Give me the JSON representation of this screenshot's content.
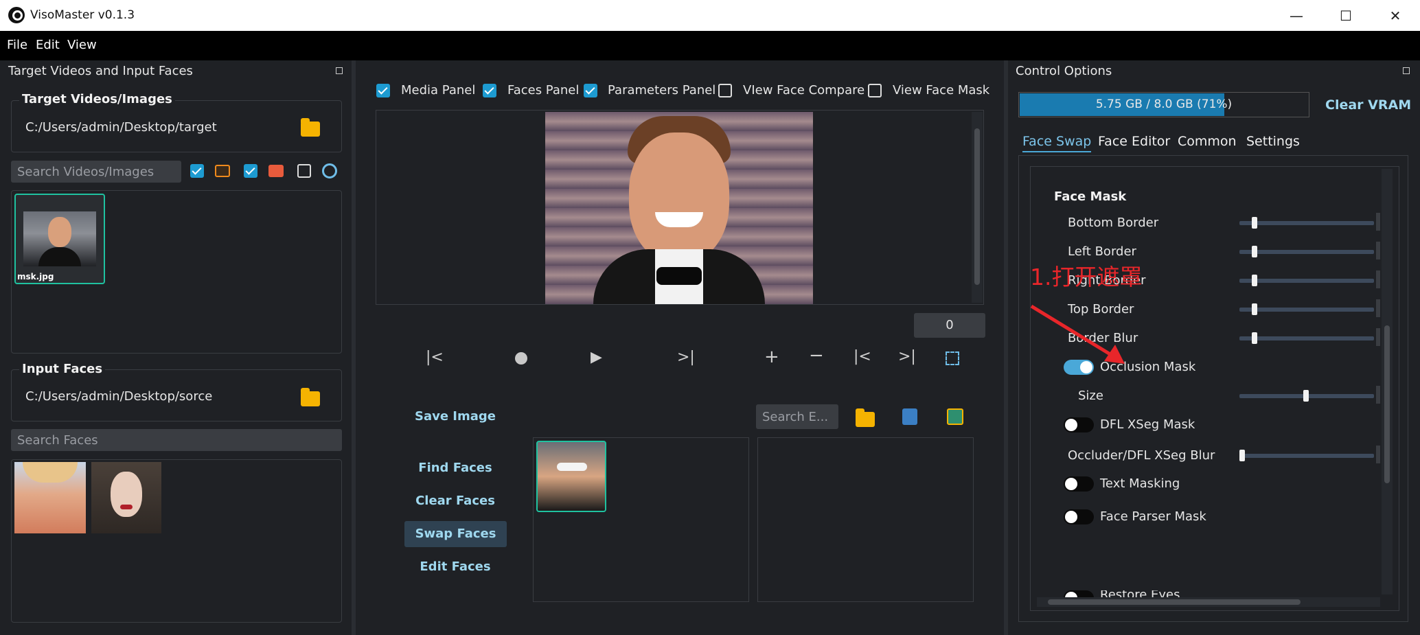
{
  "window": {
    "title": "VisoMaster v0.1.3",
    "minimize": "—",
    "maximize": "☐",
    "close": "✕"
  },
  "menu": [
    "File",
    "Edit",
    "View"
  ],
  "left": {
    "title": "Target Videos and Input Faces",
    "target_group": "Target Videos/Images",
    "target_path": "C:/Users/admin/Desktop/target",
    "target_search_placeholder": "Search Videos/Images",
    "thumb_label": "msk.jpg",
    "input_group": "Input Faces",
    "input_path": "C:/Users/admin/Desktop/sorce",
    "faces_search_placeholder": "Search Faces"
  },
  "center": {
    "checkboxes": [
      {
        "label": "Media Panel",
        "checked": true
      },
      {
        "label": "Faces Panel",
        "checked": true
      },
      {
        "label": "Parameters Panel",
        "checked": true
      },
      {
        "label": "VIew Face Compare",
        "checked": false
      },
      {
        "label": "View Face Mask",
        "checked": false
      }
    ],
    "frame_number": "0",
    "save_image": "Save Image",
    "embed_search_placeholder": "Search E...",
    "find_faces": "Find Faces",
    "clear_faces": "Clear Faces",
    "swap_faces": "Swap Faces",
    "edit_faces": "Edit Faces"
  },
  "right": {
    "title": "Control Options",
    "vram_text": "5.75 GB / 8.0 GB (71%)",
    "vram_percent": 71,
    "clear_vram": "Clear VRAM",
    "tabs": [
      "Face Swap",
      "Face Editor",
      "Common",
      "Settings"
    ],
    "section": "Face Mask",
    "params": {
      "bottom_border": "Bottom Border",
      "left_border": "Left Border",
      "right_border": "Right Border",
      "top_border": "Top Border",
      "border_blur": "Border Blur",
      "occlusion_mask": "Occlusion Mask",
      "size": "Size",
      "dfl_xseg": "DFL XSeg Mask",
      "occluder_blur": "Occluder/DFL XSeg Blur",
      "text_masking": "Text Masking",
      "face_parser": "Face Parser Mask",
      "restore_partial": "Restore Eyes"
    },
    "annotation": "1.打开遮罩"
  },
  "colors": {
    "accent": "#1d9bd1",
    "annotation": "#e8262a",
    "thumb_border": "#1fc2a0"
  }
}
